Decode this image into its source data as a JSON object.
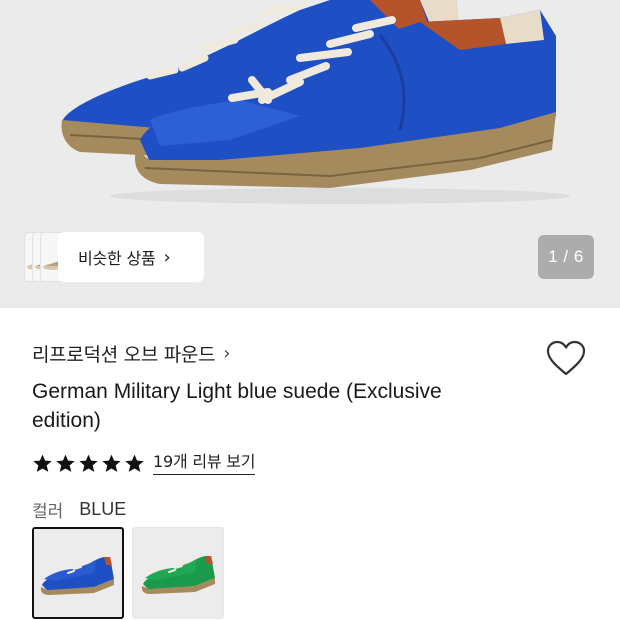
{
  "gallery": {
    "similar_products_label": "비슷한 상품",
    "similar_chevron": "›",
    "page_counter": "1 / 6",
    "current_image": 1,
    "total_images": 6
  },
  "product": {
    "brand": "리프로덕션 오브 파운드",
    "brand_chevron": "›",
    "title": "German Military Light blue suede (Exclusive edition)",
    "rating_stars": 5,
    "review_link": "19개 리뷰 보기",
    "color_label": "컬러",
    "color_value": "BLUE"
  },
  "swatches": [
    {
      "color_name": "blue",
      "color_hex": "#1e4fc4",
      "selected": true
    },
    {
      "color_name": "green",
      "color_hex": "#1a9a4a",
      "selected": false
    }
  ],
  "colors": {
    "hero_bg": "#ebebeb",
    "shoe_blue": "#1e4fc4",
    "sole": "#a58a5e",
    "star": "#111111"
  },
  "icons": [
    "heart-icon",
    "star-icon",
    "chevron-right-icon"
  ]
}
